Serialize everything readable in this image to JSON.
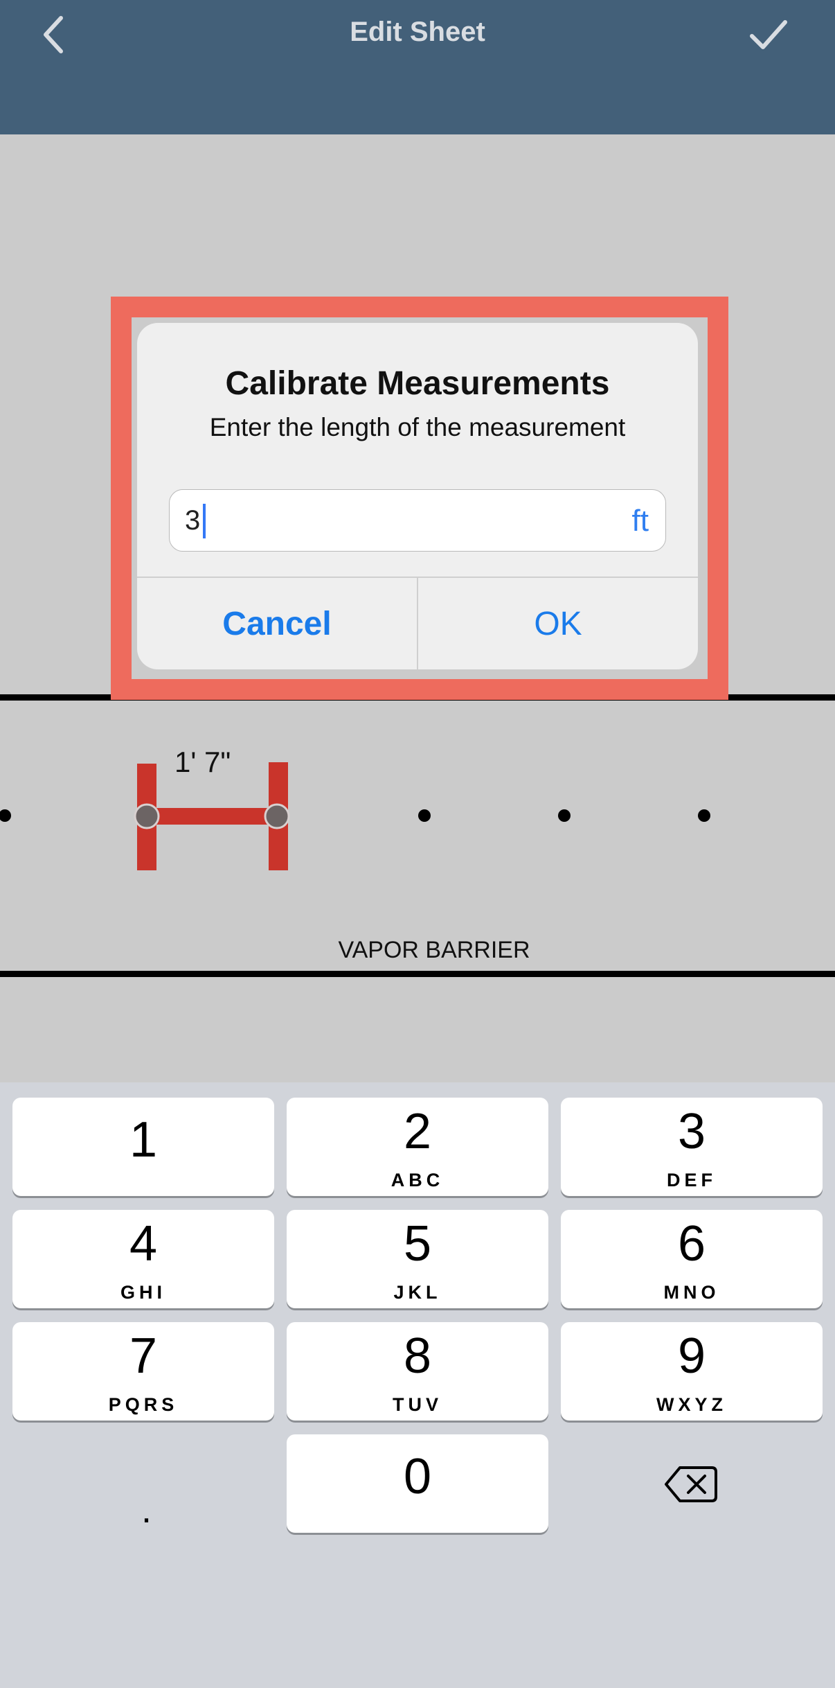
{
  "navbar": {
    "title": "Edit Sheet",
    "back_icon": "chevron-left-icon",
    "confirm_icon": "checkmark-icon",
    "background": "#436079"
  },
  "canvas": {
    "measurement_label": "1' 7\"",
    "section_label": "VAPOR BARRIER",
    "measurement_color": "#c9342b"
  },
  "dialog": {
    "title": "Calibrate Measurements",
    "message": "Enter the length of the measurement",
    "input_value": "3",
    "unit": "ft",
    "cancel_label": "Cancel",
    "ok_label": "OK",
    "highlight_color": "#ee6b5d"
  },
  "keyboard": {
    "keys": [
      {
        "num": "1",
        "letters": ""
      },
      {
        "num": "2",
        "letters": "ABC"
      },
      {
        "num": "3",
        "letters": "DEF"
      },
      {
        "num": "4",
        "letters": "GHI"
      },
      {
        "num": "5",
        "letters": "JKL"
      },
      {
        "num": "6",
        "letters": "MNO"
      },
      {
        "num": "7",
        "letters": "PQRS"
      },
      {
        "num": "8",
        "letters": "TUV"
      },
      {
        "num": "9",
        "letters": "WXYZ"
      },
      {
        "num": "0",
        "letters": ""
      }
    ],
    "decimal_label": ".",
    "delete_icon": "backspace-icon"
  }
}
